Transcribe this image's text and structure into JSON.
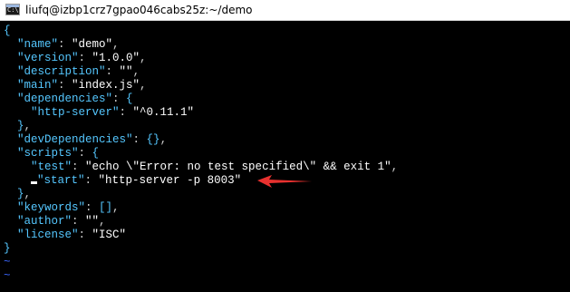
{
  "window": {
    "title": "liufq@izbp1crz7gpao046cabs25z:~/demo",
    "icon": "terminal-app-icon"
  },
  "editor": {
    "lines": [
      {
        "segments": [
          {
            "t": "{",
            "c": "b"
          }
        ]
      },
      {
        "segments": [
          {
            "t": "  \"name\"",
            "c": "k"
          },
          {
            "t": ": ",
            "c": "p"
          },
          {
            "t": "\"demo\"",
            "c": "s"
          },
          {
            "t": ",",
            "c": "p"
          }
        ]
      },
      {
        "segments": [
          {
            "t": "  \"version\"",
            "c": "k"
          },
          {
            "t": ": ",
            "c": "p"
          },
          {
            "t": "\"1.0.0\"",
            "c": "s"
          },
          {
            "t": ",",
            "c": "p"
          }
        ]
      },
      {
        "segments": [
          {
            "t": "  \"description\"",
            "c": "k"
          },
          {
            "t": ": ",
            "c": "p"
          },
          {
            "t": "\"\"",
            "c": "s"
          },
          {
            "t": ",",
            "c": "p"
          }
        ]
      },
      {
        "segments": [
          {
            "t": "  \"main\"",
            "c": "k"
          },
          {
            "t": ": ",
            "c": "p"
          },
          {
            "t": "\"index.js\"",
            "c": "s"
          },
          {
            "t": ",",
            "c": "p"
          }
        ]
      },
      {
        "segments": [
          {
            "t": "  \"dependencies\"",
            "c": "k"
          },
          {
            "t": ": ",
            "c": "p"
          },
          {
            "t": "{",
            "c": "b"
          }
        ]
      },
      {
        "segments": [
          {
            "t": "    \"http-server\"",
            "c": "k"
          },
          {
            "t": ": ",
            "c": "p"
          },
          {
            "t": "\"^0.11.1\"",
            "c": "s"
          }
        ]
      },
      {
        "segments": [
          {
            "t": "  }",
            "c": "b"
          },
          {
            "t": ",",
            "c": "p"
          }
        ]
      },
      {
        "segments": [
          {
            "t": "  \"devDependencies\"",
            "c": "k"
          },
          {
            "t": ": ",
            "c": "p"
          },
          {
            "t": "{}",
            "c": "b"
          },
          {
            "t": ",",
            "c": "p"
          }
        ]
      },
      {
        "segments": [
          {
            "t": "  \"scripts\"",
            "c": "k"
          },
          {
            "t": ": ",
            "c": "p"
          },
          {
            "t": "{",
            "c": "b"
          }
        ]
      },
      {
        "segments": [
          {
            "t": "    \"test\"",
            "c": "k"
          },
          {
            "t": ": ",
            "c": "p"
          },
          {
            "t": "\"echo \\\"Error: no test specified\\\" && exit 1\"",
            "c": "s"
          },
          {
            "t": ",",
            "c": "p"
          }
        ]
      },
      {
        "cursor": true,
        "segments": [
          {
            "t": "    ",
            "c": "p"
          },
          {
            "t": "\"start\"",
            "c": "k"
          },
          {
            "t": ": ",
            "c": "p"
          },
          {
            "t": "\"http-server -p 8003\"",
            "c": "s"
          }
        ]
      },
      {
        "segments": [
          {
            "t": "  }",
            "c": "b"
          },
          {
            "t": ",",
            "c": "p"
          }
        ]
      },
      {
        "segments": [
          {
            "t": "  \"keywords\"",
            "c": "k"
          },
          {
            "t": ": ",
            "c": "p"
          },
          {
            "t": "[]",
            "c": "b"
          },
          {
            "t": ",",
            "c": "p"
          }
        ]
      },
      {
        "segments": [
          {
            "t": "  \"author\"",
            "c": "k"
          },
          {
            "t": ": ",
            "c": "p"
          },
          {
            "t": "\"\"",
            "c": "s"
          },
          {
            "t": ",",
            "c": "p"
          }
        ]
      },
      {
        "segments": [
          {
            "t": "  \"license\"",
            "c": "k"
          },
          {
            "t": ": ",
            "c": "p"
          },
          {
            "t": "\"ISC\"",
            "c": "s"
          }
        ]
      },
      {
        "segments": [
          {
            "t": "}",
            "c": "b"
          }
        ]
      },
      {
        "segments": [
          {
            "t": "~",
            "c": "tilde"
          }
        ]
      },
      {
        "segments": [
          {
            "t": "~",
            "c": "tilde"
          }
        ]
      }
    ]
  },
  "annotation": {
    "type": "red-arrow",
    "points_to": "start script line",
    "color": "#e8312f"
  },
  "colors": {
    "key": "#55c7ff",
    "string": "#ffffff",
    "tilde": "#3a66ff",
    "background": "#000000"
  }
}
